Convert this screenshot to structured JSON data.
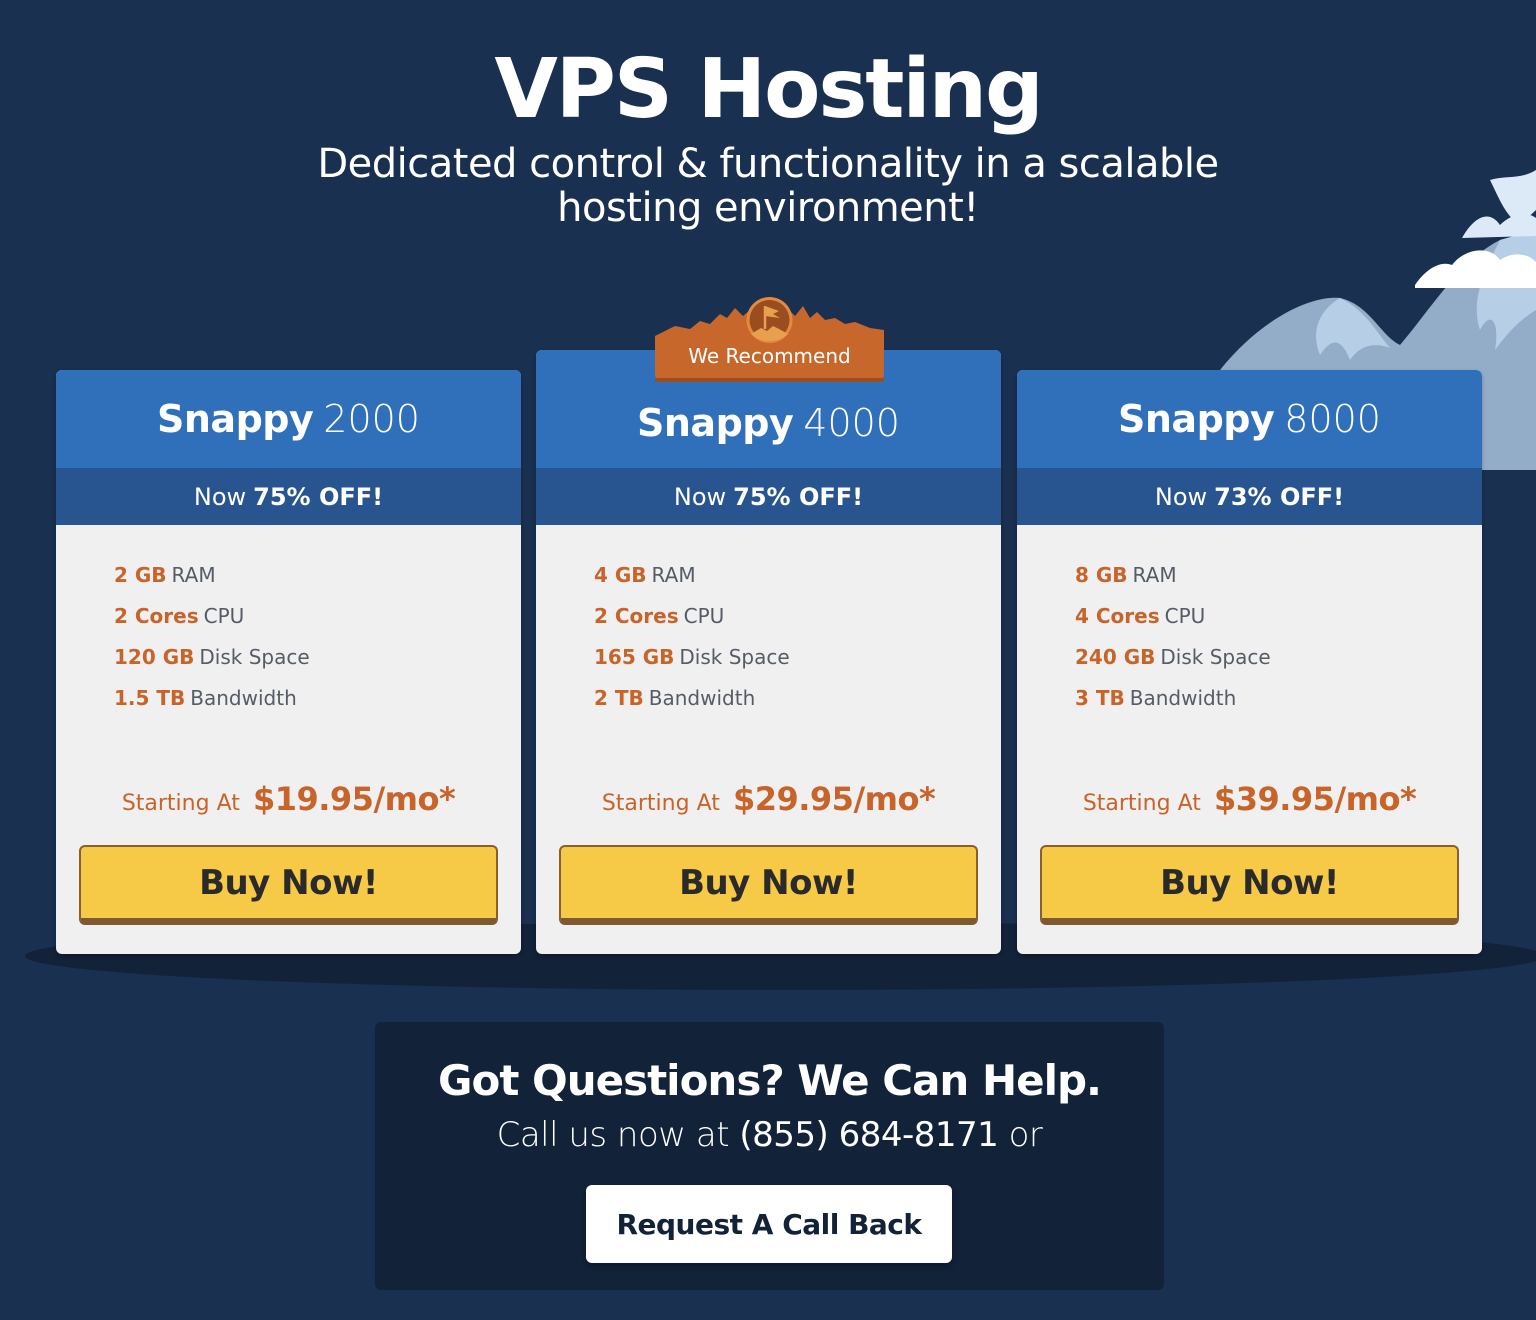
{
  "header": {
    "title": "VPS Hosting",
    "subtitle": "Dedicated control & functionality in a scalable hosting environment!"
  },
  "badge": {
    "label": "We Recommend",
    "icon": "mountain-flag-icon"
  },
  "plans": [
    {
      "brand": "Snappy",
      "model": "2000",
      "discount_prefix": "Now",
      "discount": "75% OFF!",
      "features": [
        {
          "value": "2 GB",
          "label": "RAM"
        },
        {
          "value": "2 Cores",
          "label": "CPU"
        },
        {
          "value": "120 GB",
          "label": "Disk Space"
        },
        {
          "value": "1.5 TB",
          "label": "Bandwidth"
        }
      ],
      "price_label": "Starting At",
      "price": "$19.95/mo*",
      "button": "Buy Now!"
    },
    {
      "brand": "Snappy",
      "model": "4000",
      "discount_prefix": "Now",
      "discount": "75% OFF!",
      "features": [
        {
          "value": "4 GB",
          "label": "RAM"
        },
        {
          "value": "2 Cores",
          "label": "CPU"
        },
        {
          "value": "165 GB",
          "label": "Disk Space"
        },
        {
          "value": "2 TB",
          "label": "Bandwidth"
        }
      ],
      "price_label": "Starting At",
      "price": "$29.95/mo*",
      "button": "Buy Now!"
    },
    {
      "brand": "Snappy",
      "model": "8000",
      "discount_prefix": "Now",
      "discount": "73% OFF!",
      "features": [
        {
          "value": "8 GB",
          "label": "RAM"
        },
        {
          "value": "4 Cores",
          "label": "CPU"
        },
        {
          "value": "240 GB",
          "label": "Disk Space"
        },
        {
          "value": "3 TB",
          "label": "Bandwidth"
        }
      ],
      "price_label": "Starting At",
      "price": "$39.95/mo*",
      "button": "Buy Now!"
    }
  ],
  "help": {
    "title": "Got Questions? We Can Help.",
    "call_prefix": "Call us now at",
    "phone": "(855) 684-8171",
    "call_suffix": "or",
    "button": "Request A Call Back"
  },
  "colors": {
    "background": "#1a3050",
    "card_header": "#3070bb",
    "card_discount": "#285490",
    "accent_orange": "#c8642a",
    "button_yellow": "#f6ca47"
  }
}
